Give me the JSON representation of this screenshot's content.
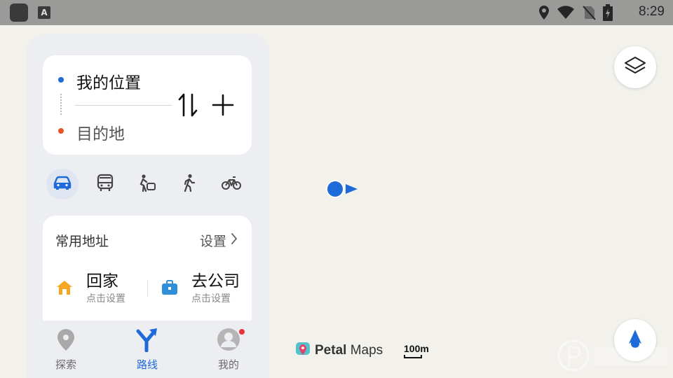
{
  "status_bar": {
    "time": "8:29",
    "icons": [
      "app-icon",
      "a-icon",
      "location-icon",
      "wifi-icon",
      "no-sim-icon",
      "battery-icon"
    ]
  },
  "route_card": {
    "from": "我的位置",
    "to": "目的地",
    "swap_icon": "swap-icon",
    "add_icon": "plus-icon"
  },
  "transport_modes": [
    {
      "icon": "car-icon",
      "active": true
    },
    {
      "icon": "bus-icon",
      "active": false
    },
    {
      "icon": "taxi-icon",
      "active": false
    },
    {
      "icon": "walk-icon",
      "active": false
    },
    {
      "icon": "bike-icon",
      "active": false
    }
  ],
  "favorites": {
    "title": "常用地址",
    "setting_label": "设置",
    "items": [
      {
        "name": "回家",
        "sub": "点击设置",
        "icon": "home-icon"
      },
      {
        "name": "去公司",
        "sub": "点击设置",
        "icon": "briefcase-icon"
      }
    ]
  },
  "bottom_nav": [
    {
      "label": "探索",
      "icon": "explore-pin-icon",
      "active": false
    },
    {
      "label": "路线",
      "icon": "route-icon",
      "active": true
    },
    {
      "label": "我的",
      "icon": "avatar-icon",
      "active": false
    }
  ],
  "map": {
    "brand_bold": "Petal",
    "brand_light": "Maps",
    "scale": "100m"
  },
  "colors": {
    "accent": "#1f6ad9",
    "destination": "#e8552c",
    "home": "#f5a623",
    "work": "#2f8fd8"
  }
}
